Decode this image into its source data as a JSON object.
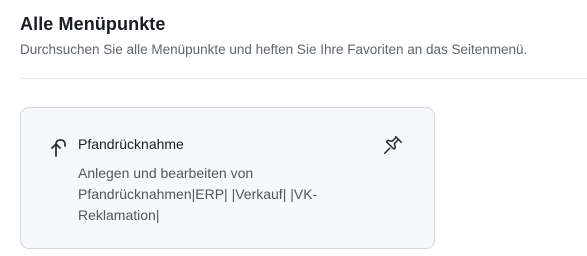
{
  "header": {
    "title": "Alle Menüpunkte",
    "subtitle": "Durchsuchen Sie alle Menüpunkte und heften Sie Ihre Favoriten an das Seitenmenü."
  },
  "cards": [
    {
      "icon": "return-arrow-icon",
      "title": "Pfandrücknahme",
      "description": "Anlegen und bearbeiten von Pfandrücknahmen|ERP| |Verkauf| |VK-Reklamation|",
      "pin_icon": "pin-icon"
    }
  ]
}
